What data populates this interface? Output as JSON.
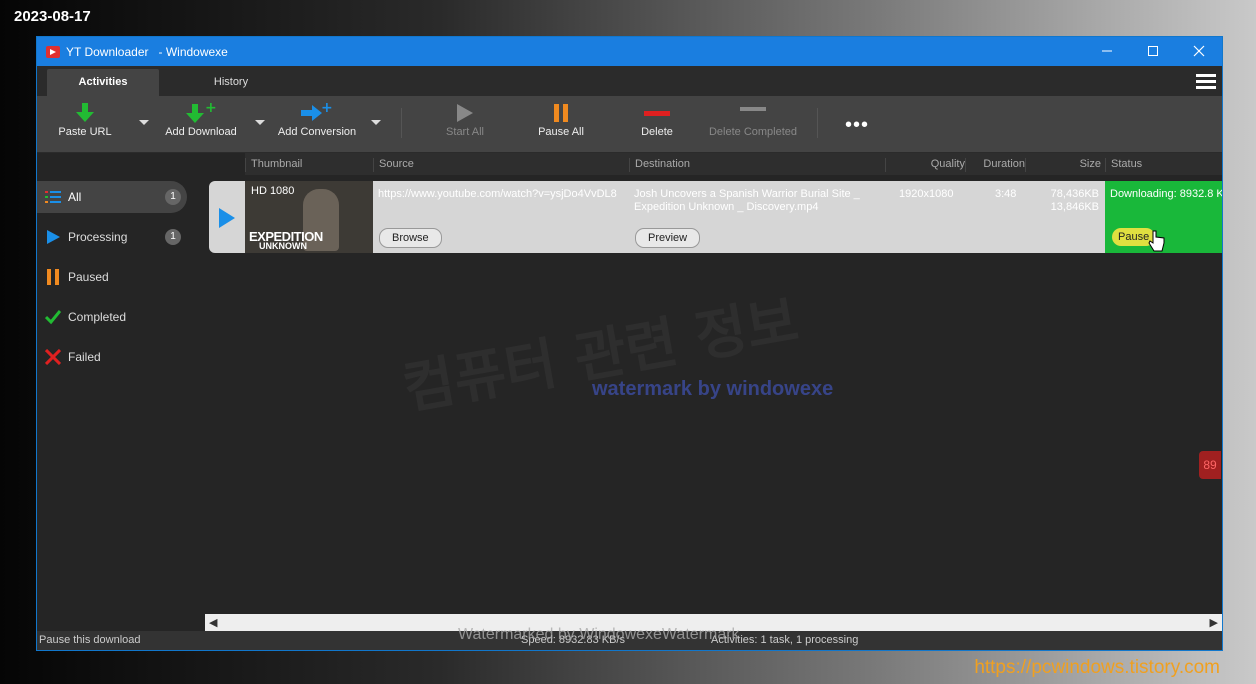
{
  "overlay": {
    "date": "2023-08-17",
    "site_url": "https://pcwindows.tistory.com",
    "watermark_main": "컴퓨터 관련 정보",
    "watermark_sub": "watermark by windowexe",
    "watermark_bottom": "Watermarked by WindowexeWatermark",
    "edge_badge": "89"
  },
  "window": {
    "app_name": "YT Downloader",
    "title_suffix": "- Windowexe",
    "controls": [
      "minimize",
      "maximize",
      "close"
    ]
  },
  "tabs": [
    {
      "label": "Activities",
      "active": true
    },
    {
      "label": "History",
      "active": false
    }
  ],
  "toolbar": {
    "paste_url": "Paste URL",
    "add_download": "Add Download",
    "add_conversion": "Add Conversion",
    "start_all": "Start All",
    "pause_all": "Pause All",
    "delete": "Delete",
    "delete_completed": "Delete Completed",
    "more": "•••"
  },
  "columns": {
    "thumbnail": "Thumbnail",
    "source": "Source",
    "destination": "Destination",
    "quality": "Quality",
    "duration": "Duration",
    "size": "Size",
    "status": "Status"
  },
  "sidebar": {
    "items": [
      {
        "label": "All",
        "count": "1",
        "active": true,
        "icon": "list-icon"
      },
      {
        "label": "Processing",
        "count": "1",
        "active": false,
        "icon": "play-icon"
      },
      {
        "label": "Paused",
        "count": "",
        "active": false,
        "icon": "pause-icon"
      },
      {
        "label": "Completed",
        "count": "",
        "active": false,
        "icon": "check-icon"
      },
      {
        "label": "Failed",
        "count": "",
        "active": false,
        "icon": "x-icon"
      }
    ]
  },
  "download": {
    "thumb_quality": "HD 1080",
    "thumb_title_1": "EXPEDITION",
    "thumb_title_2": "UNKNOWN",
    "source": "https://www.youtube.com/watch?v=ysjDo4VvDL8",
    "destination_line1": "Josh Uncovers a Spanish Warrior Burial Site _",
    "destination_line2": "Expedition Unknown _ Discovery.mp4",
    "browse_label": "Browse",
    "preview_label": "Preview",
    "quality": "1920x1080",
    "duration": "3:48",
    "size_total": "78,436KB",
    "size_done": "13,846KB",
    "status": "Downloading: 8932.8 K",
    "pause_label": "Pause"
  },
  "statusbar": {
    "hint": "Pause this download",
    "speed": "Speed: 8932.83 KB/s",
    "activities": "Activities: 1 task, 1 processing"
  },
  "colors": {
    "titlebar": "#1a7ee0",
    "status_green": "#19b83a",
    "pause_orange": "#f08a20",
    "delete_red": "#e02020",
    "add_green": "#22bb33",
    "add_blue": "#1a8fe8"
  }
}
